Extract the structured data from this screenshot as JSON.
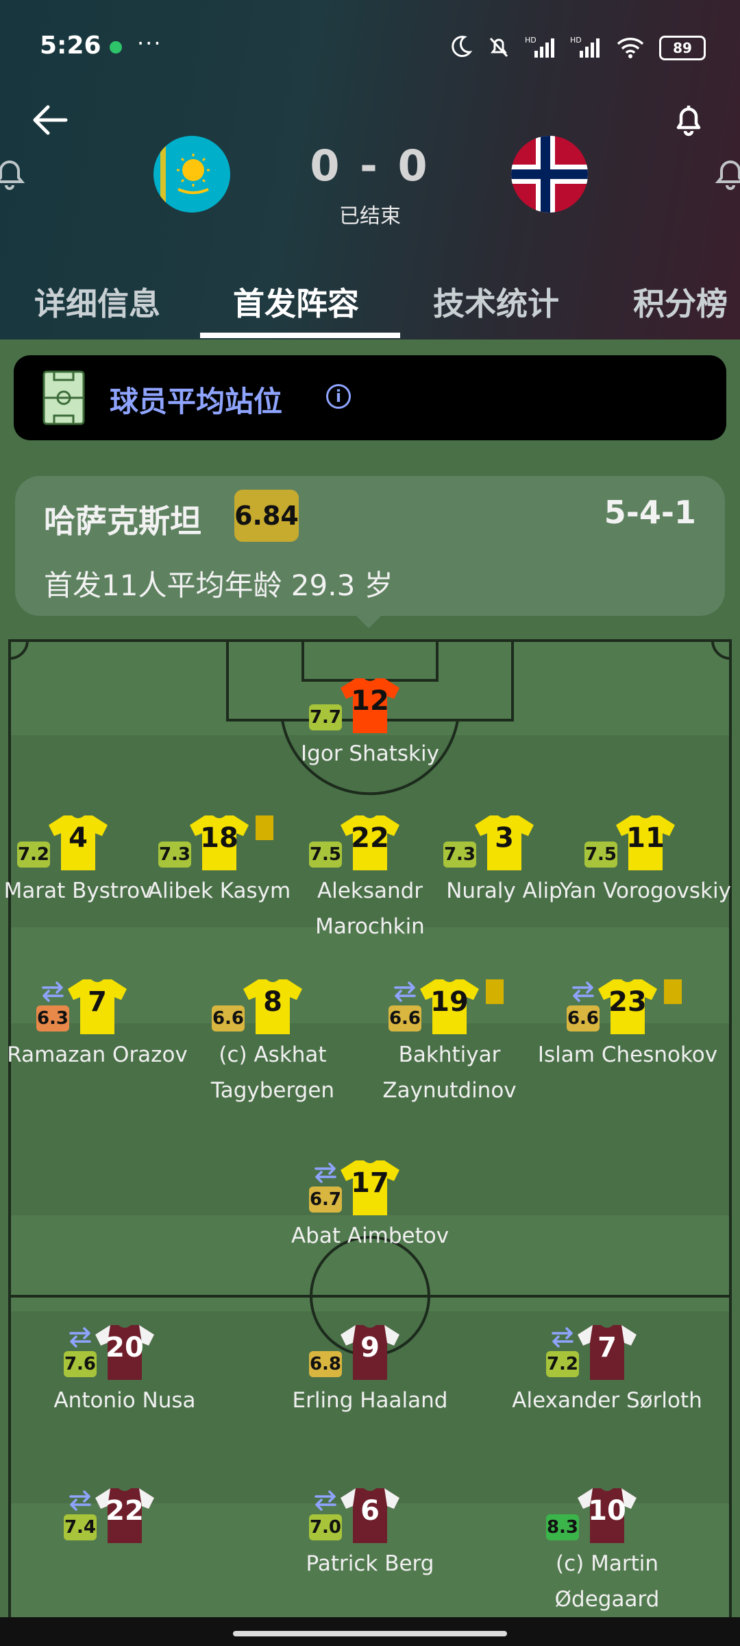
{
  "status_bar": {
    "time": "5:26",
    "more": "···",
    "battery": "89"
  },
  "match": {
    "score": "0 - 0",
    "status": "已结束",
    "home_flag": "kazakhstan-flag",
    "away_flag": "norway-flag"
  },
  "tabs": [
    {
      "label": "详细信息"
    },
    {
      "label": "首发阵容"
    },
    {
      "label": "技术统计"
    },
    {
      "label": "积分榜"
    }
  ],
  "avg_position": {
    "label": "球员平均站位",
    "info": "i"
  },
  "team": {
    "name": "哈萨克斯坦",
    "rating": "6.84",
    "formation": "5-4-1",
    "avg_age": "首发11人平均年龄  29.3 岁"
  },
  "colors": {
    "rating_yellowgreen": "#a7c43a",
    "rating_gold": "#d9b640",
    "rating_orange": "#e8894a",
    "rating_green": "#3bb54a",
    "home_kit": "#f5e100",
    "home_gk_kit": "#ff4500",
    "away_kit": "#6e1f2b"
  },
  "players": [
    {
      "number": "12",
      "name": "Igor Shatskiy",
      "rating": "7.7",
      "kit": "home-gk"
    },
    {
      "number": "4",
      "name": "Marat Bystrov",
      "rating": "7.2",
      "kit": "home"
    },
    {
      "number": "18",
      "name": "Alibek Kasym",
      "rating": "7.3",
      "kit": "home",
      "yellow": true
    },
    {
      "number": "22",
      "name": "Aleksandr Marochkin",
      "rating": "7.5",
      "kit": "home"
    },
    {
      "number": "3",
      "name": "Nuraly Alip",
      "rating": "7.3",
      "kit": "home"
    },
    {
      "number": "11",
      "name": "Yan Vorogovskiy",
      "rating": "7.5",
      "kit": "home"
    },
    {
      "number": "7",
      "name": "Ramazan Orazov",
      "rating": "6.3",
      "kit": "home",
      "sub": true
    },
    {
      "number": "8",
      "name": "(c) Askhat Tagybergen",
      "rating": "6.6",
      "kit": "home"
    },
    {
      "number": "19",
      "name": "Bakhtiyar Zaynutdinov",
      "rating": "6.6",
      "kit": "home",
      "sub": true,
      "yellow": true
    },
    {
      "number": "23",
      "name": "Islam Chesnokov",
      "rating": "6.6",
      "kit": "home",
      "sub": true,
      "yellow": true
    },
    {
      "number": "17",
      "name": "Abat Aimbetov",
      "rating": "6.7",
      "kit": "home",
      "sub": true
    },
    {
      "number": "20",
      "name": "Antonio Nusa",
      "rating": "7.6",
      "kit": "away",
      "sub": true
    },
    {
      "number": "9",
      "name": "Erling Haaland",
      "rating": "6.8",
      "kit": "away"
    },
    {
      "number": "7",
      "name": "Alexander Sørloth",
      "rating": "7.2",
      "kit": "away",
      "sub": true
    },
    {
      "number": "22",
      "name": "",
      "rating": "7.4",
      "kit": "away",
      "sub": true
    },
    {
      "number": "6",
      "name": "Patrick Berg",
      "rating": "7.0",
      "kit": "away",
      "sub": true
    },
    {
      "number": "10",
      "name": "(c) Martin Ødegaard",
      "rating": "8.3",
      "kit": "away"
    }
  ]
}
